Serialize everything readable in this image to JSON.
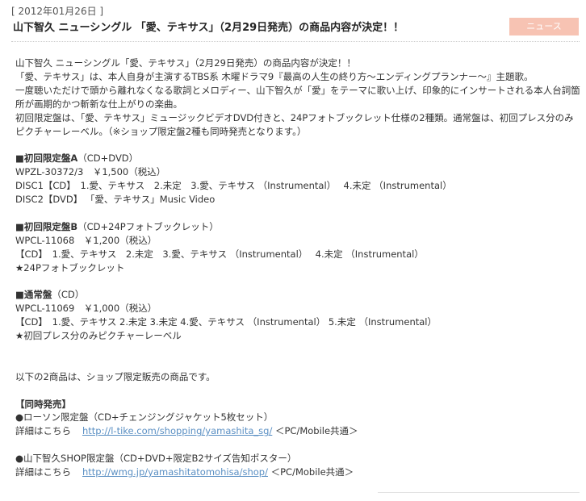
{
  "post": {
    "date": "[ 2012年01月26日 ]",
    "title": "山下智久 ニューシングル 「愛、テキサス」（2月29日発売）の商品内容が決定！！",
    "news_tab": "ニュース"
  },
  "body": {
    "intro": [
      "山下智久 ニューシングル「愛、テキサス」（2月29日発売）の商品内容が決定！！",
      "「愛、テキサス」は、本人自身が主演するTBS系 木曜ドラマ9『最高の人生の終り方～エンディングプランナー～』主題歌。",
      "一度聴いただけで頭から離れなくなる歌詞とメロディー、山下智久が「愛」をテーマに歌い上げ、印象的にインサートされる本人台詞箇所が画期的かつ斬新な仕上がりの楽曲。",
      "初回限定盤は、「愛、テキサス」ミュージックビデオDVD付きと、24Pフォトブックレット仕様の2種類。通常盤は、初回プレス分のみピクチャーレーベル。（※ショップ限定盤2種も同時発売となります。）"
    ],
    "editionA": {
      "name": "■初回限定盤A",
      "sub": "（CD+DVD）",
      "code_price": "WPZL-30372/3　￥1,500（税込）",
      "disc1": "DISC1【CD】　1.愛、テキサス　2.未定　3.愛、テキサス （Instrumental）　 4.未定 （Instrumental）",
      "disc2": "DISC2【DVD】 「愛、テキサス」Music Video"
    },
    "editionB": {
      "name": "■初回限定盤B",
      "sub": "（CD+24Pフォトブックレット）",
      "code_price": "WPCL-11068　￥1,200（税込）",
      "cd": "【CD】　1.愛、テキサス　2.未定　3.愛、テキサス （Instrumental）　 4.未定 （Instrumental）",
      "bonus": "★24Pフォトブックレット"
    },
    "editionR": {
      "name": "■通常盤",
      "sub": "（CD）",
      "code_price": "WPCL-11069　￥1,000（税込）",
      "cd": "【CD】　1.愛、テキサス 2.未定 3.未定 4.愛、テキサス （Instrumental） 5.未定 （Instrumental）",
      "bonus": "★初回プレス分のみピクチャーレーベル"
    },
    "shop_note": "以下の2商品は、ショップ限定販売の商品です。",
    "simultaneous": {
      "header": "【同時発売】",
      "lawson": {
        "name": "●ローソン限定盤（CD+チェンジングジャケット5枚セット）",
        "detail_label": "詳細はこちら",
        "link": "http://l-tike.com/shopping/yamashita_sg/",
        "suffix": "＜PC/Mobile共通＞"
      },
      "shop": {
        "name": "●山下智久SHOP限定盤（CD+DVD+限定B2サイズ告知ポスター）",
        "detail_label": "詳細はこちら",
        "link": "http://wmg.jp/yamashitatomohisa/shop/",
        "suffix": "＜PC/Mobile共通＞"
      }
    }
  }
}
